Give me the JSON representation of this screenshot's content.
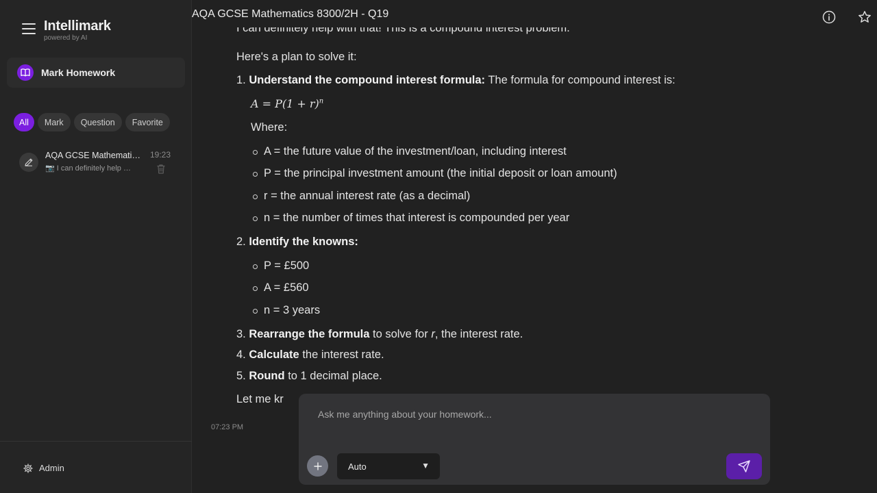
{
  "app": {
    "brand": "Intellimark",
    "tagline": "powered by AI"
  },
  "sidebar": {
    "mark_homework": "Mark Homework",
    "filters": [
      "All",
      "Mark",
      "Question",
      "Favorite"
    ],
    "active_filter": "All",
    "conversations": [
      {
        "title": "AQA GCSE Mathematics 8300/2H - Q19",
        "preview": "📷 I can definitely help with that!",
        "time": "19:23"
      }
    ],
    "admin_label": "Admin"
  },
  "header": {
    "title": "AQA GCSE Mathematics 8300/2H - Q19"
  },
  "message": {
    "intro_clipped": "I can definitely help with that! This is a compound interest problem.",
    "plan_intro": "Here's a plan to solve it:",
    "step1_num": "1.",
    "step1_bold": "Understand the compound interest formula:",
    "step1_rest": "The formula for compound interest is:",
    "formula_main": "A = P(1 + r)",
    "formula_exp": "n",
    "where": "Where:",
    "definitions": [
      "A = the future value of the investment/loan, including interest",
      "P = the principal investment amount (the initial deposit or loan amount)",
      "r = the annual interest rate (as a decimal)",
      "n = the number of times that interest is compounded per year"
    ],
    "step2_num": "2.",
    "step2_bold": "Identify the knowns:",
    "knowns": [
      "P = £500",
      "A = £560",
      "n = 3 years"
    ],
    "step3_num": "3.",
    "step3_bold": "Rearrange the formula",
    "step3_rest_a": "to solve for",
    "step3_var": "r",
    "step3_rest_b": ", the interest rate.",
    "step4_num": "4.",
    "step4_bold": "Calculate",
    "step4_rest": "the interest rate.",
    "step5_num": "5.",
    "step5_bold": "Round",
    "step5_rest": "to 1 decimal place.",
    "closing_clipped": "Let me kr",
    "timestamp": "07:23 PM"
  },
  "composer": {
    "placeholder": "Ask me anything about your homework...",
    "model": "Auto"
  },
  "colors": {
    "accent": "#7b1fe0",
    "send": "#5b1fa8",
    "background": "#212121",
    "sidebar": "#252525"
  }
}
